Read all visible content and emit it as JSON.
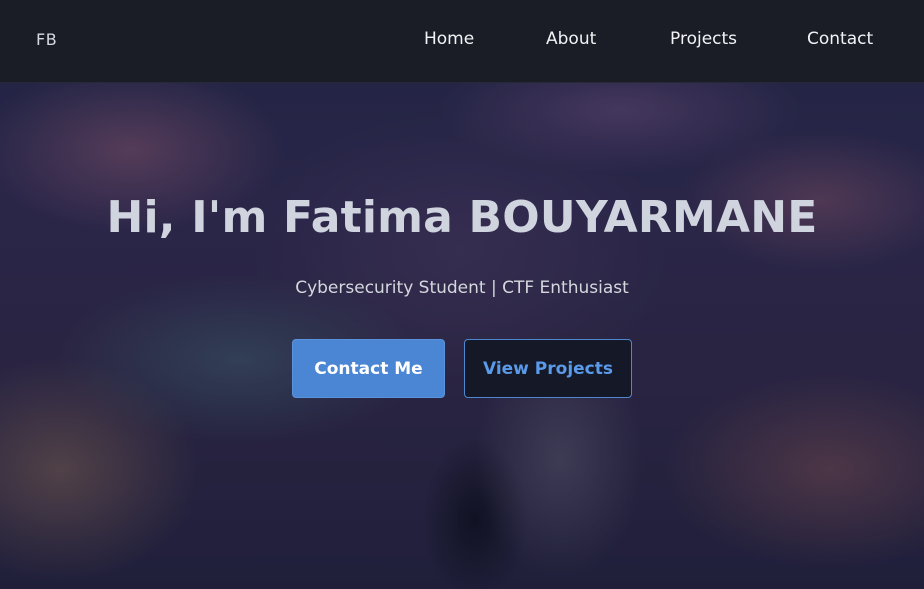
{
  "navbar": {
    "logo": "FB",
    "links": [
      {
        "label": "Home"
      },
      {
        "label": "About"
      },
      {
        "label": "Projects"
      },
      {
        "label": "Contact"
      }
    ]
  },
  "hero": {
    "title": "Hi, I'm Fatima BOUYARMANE",
    "subtitle": "Cybersecurity Student | CTF Enthusiast",
    "primary_button": "Contact Me",
    "secondary_button": "View Projects"
  },
  "colors": {
    "navbar_bg": "#1a1d26",
    "accent": "#4a86d4",
    "secondary_button_text": "#5a9ae8"
  }
}
